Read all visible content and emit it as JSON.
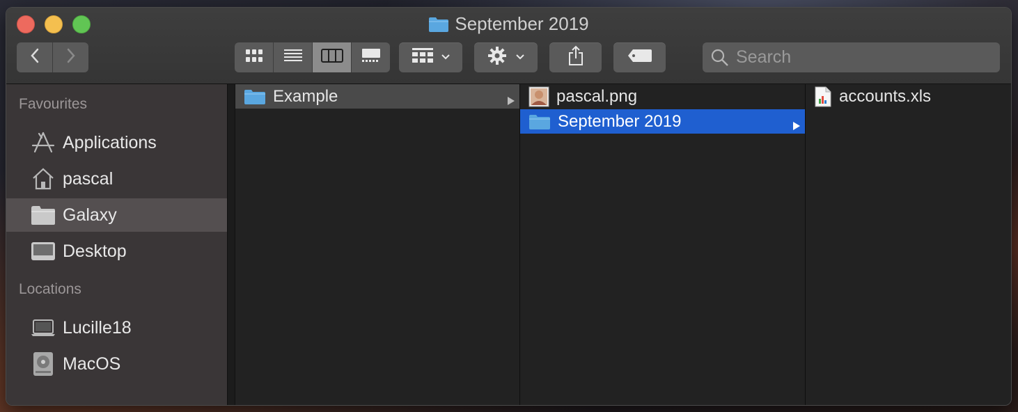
{
  "window": {
    "title": "September 2019"
  },
  "toolbar": {
    "back_icon": "chevron-left-icon",
    "forward_icon": "chevron-right-icon",
    "view_modes": [
      "icon-view",
      "list-view",
      "column-view",
      "gallery-view"
    ],
    "active_view": "column-view",
    "group_icon": "group-by-icon",
    "action_icon": "gear-icon",
    "share_icon": "share-icon",
    "tag_icon": "tag-icon",
    "search_placeholder": "Search"
  },
  "sidebar": {
    "favourites_label": "Favourites",
    "favourites": [
      {
        "label": "Applications",
        "icon": "applications-icon"
      },
      {
        "label": "pascal",
        "icon": "home-icon"
      },
      {
        "label": "Galaxy",
        "icon": "folder-icon",
        "selected": true
      },
      {
        "label": "Desktop",
        "icon": "desktop-icon"
      }
    ],
    "locations_label": "Locations",
    "locations": [
      {
        "label": "Lucille18",
        "icon": "laptop-icon"
      },
      {
        "label": "MacOS",
        "icon": "hard-drive-icon"
      }
    ]
  },
  "columns": [
    {
      "items": [
        {
          "label": "Example",
          "icon": "folder-icon",
          "selected": "gray"
        }
      ]
    },
    {
      "items": [
        {
          "label": "pascal.png",
          "icon": "image-file-icon"
        },
        {
          "label": "September 2019",
          "icon": "folder-icon",
          "selected": "blue"
        }
      ]
    },
    {
      "items": [
        {
          "label": "accounts.xls",
          "icon": "spreadsheet-file-icon"
        }
      ]
    }
  ],
  "colors": {
    "selection_blue": "#1f5fd0",
    "folder_blue": "#5aa7e0"
  }
}
